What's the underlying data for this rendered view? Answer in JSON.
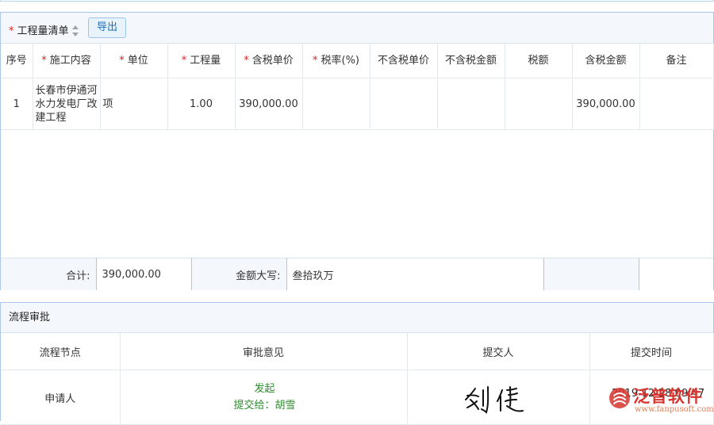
{
  "bill": {
    "title": "工程量清单",
    "export_label": "导出",
    "headers": [
      "序号",
      "施工内容",
      "单位",
      "工程量",
      "含税单价",
      "税率(%)",
      "不含税单价",
      "不含税金额",
      "税额",
      "含税金额",
      "备注"
    ],
    "rows": [
      {
        "no": "1",
        "content": "长春市伊通河水力发电厂改建工程",
        "unit": "项",
        "qty": "1.00",
        "unit_price": "390,000.00",
        "tax_rate": "",
        "ex_price": "",
        "ex_amount": "",
        "tax": "",
        "amount": "390,000.00",
        "remark": ""
      }
    ],
    "total": {
      "label": "合计:",
      "value": "390,000.00",
      "upper_label": "金额大写:",
      "upper_value": "叁拾玖万"
    }
  },
  "flow": {
    "title": "流程审批",
    "headers": [
      "流程节点",
      "审批意见",
      "提交人",
      "提交时间"
    ],
    "rows": [
      {
        "node": "申请人",
        "opinion": "发起",
        "forward": "提交给：胡雪",
        "submitter_signature": "刘健",
        "time": "2019-12-28 09:47"
      }
    ]
  },
  "watermark": {
    "name": "泛普软件",
    "url": "www.fanpusoft.com"
  },
  "colors": {
    "accent": "#1a6fb8",
    "required": "#e02020",
    "approve_text": "#2e8b2e",
    "watermark": "#d8342f"
  }
}
